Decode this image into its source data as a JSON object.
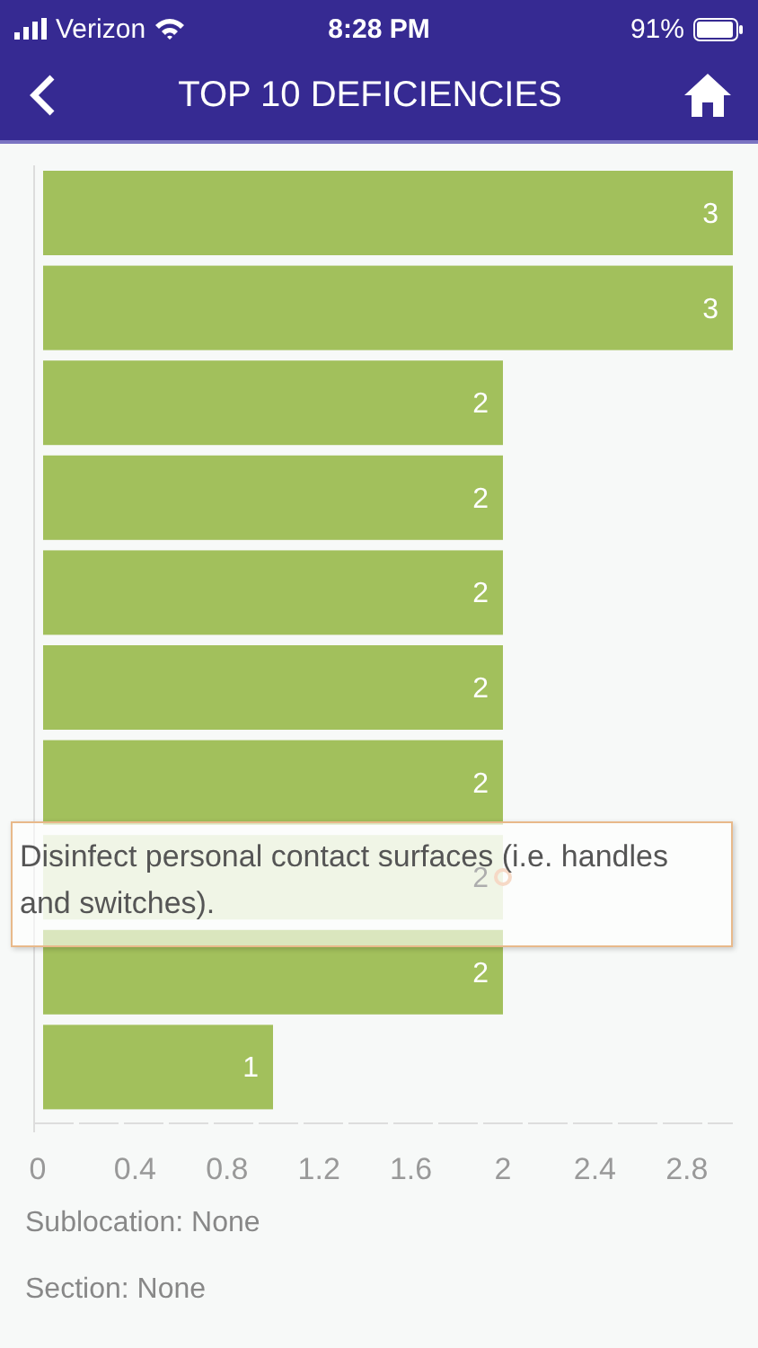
{
  "status_bar": {
    "carrier": "Verizon",
    "time": "8:28 PM",
    "battery": "91%"
  },
  "nav_bar": {
    "title": "TOP 10 DEFICIENCIES"
  },
  "chart": {
    "chart_data": {
      "type": "bar",
      "orientation": "horizontal",
      "data_labels": true,
      "xlim": [
        0,
        3
      ],
      "xticks": [
        0,
        {
          "value": 0.4,
          "label": "0.4"
        },
        {
          "value": 0.8,
          "label": "0.8"
        },
        {
          "value": 1.2,
          "label": "1.2"
        },
        {
          "value": 1.6,
          "label": "1.6"
        },
        2,
        {
          "value": 2.4,
          "label": "2.4"
        },
        {
          "value": 2.8,
          "label": "2.8"
        }
      ],
      "series": [
        {
          "color": "#a2c05c",
          "values": [
            3,
            3,
            2,
            2,
            2,
            2,
            2,
            2,
            2,
            1
          ]
        }
      ]
    },
    "bar_states": [
      {
        "highlighted": false
      },
      {
        "highlighted": false
      },
      {
        "highlighted": false
      },
      {
        "highlighted": false
      },
      {
        "highlighted": false
      },
      {
        "highlighted": false
      },
      {
        "highlighted": false
      },
      {
        "highlighted": true
      },
      {
        "highlighted": false
      },
      {
        "highlighted": false
      }
    ],
    "tooltip": {
      "text": "Disinfect personal contact surfaces (i.e. handles and switches)."
    }
  },
  "details": [
    {
      "text": "Sublocation: None"
    },
    {
      "text": "Section: None"
    }
  ]
}
